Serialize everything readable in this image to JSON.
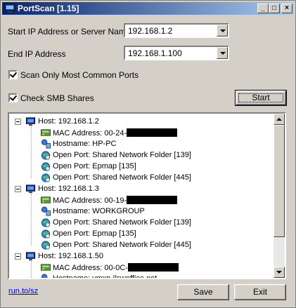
{
  "window": {
    "title": "PortScan [1.15]"
  },
  "title_buttons": {
    "minimize": "_",
    "maximize": "□",
    "close": "×"
  },
  "form": {
    "start_ip_label": "Start IP Address or Server Name",
    "start_ip_value": "192.168.1.2",
    "end_ip_label": "End IP Address",
    "end_ip_value": "192.168.1.100",
    "common_ports_label": "Scan Only Most Common Ports",
    "smb_label": "Check SMB Shares",
    "start_button": "Start"
  },
  "tree": {
    "rows": [
      {
        "type": "host",
        "label": "Host: 192.168.1.2"
      },
      {
        "type": "mac",
        "label": "MAC Address: 00-24-",
        "redacted": true
      },
      {
        "type": "hostname",
        "label": "Hostname: HP-PC"
      },
      {
        "type": "port",
        "label": "Open Port: Shared Network Folder [139]"
      },
      {
        "type": "port",
        "label": "Open Port: Epmap [135]"
      },
      {
        "type": "port",
        "label": "Open Port: Shared Network Folder [445]"
      },
      {
        "type": "host",
        "label": "Host: 192.168.1.3"
      },
      {
        "type": "mac",
        "label": "MAC Address: 00-19-",
        "redacted": true
      },
      {
        "type": "hostname",
        "label": "Hostname: WORKGROUP"
      },
      {
        "type": "port",
        "label": "Open Port: Shared Network Folder [139]"
      },
      {
        "type": "port",
        "label": "Open Port: Epmap [135]"
      },
      {
        "type": "port",
        "label": "Open Port: Shared Network Folder [445]"
      },
      {
        "type": "host",
        "label": "Host: 192.168.1.50"
      },
      {
        "type": "mac",
        "label": "MAC Address: 00-0C-",
        "redacted": true
      },
      {
        "type": "hostname",
        "label": "Hostname: vmxp.ilswoffice.net"
      }
    ]
  },
  "footer": {
    "link": "run.to/sz",
    "save_button": "Save",
    "exit_button": "Exit"
  },
  "colors": {
    "title_gradient_start": "#0a246a",
    "title_gradient_end": "#a6caf0",
    "window_face": "#d4d0c8",
    "link": "#0000ee"
  }
}
